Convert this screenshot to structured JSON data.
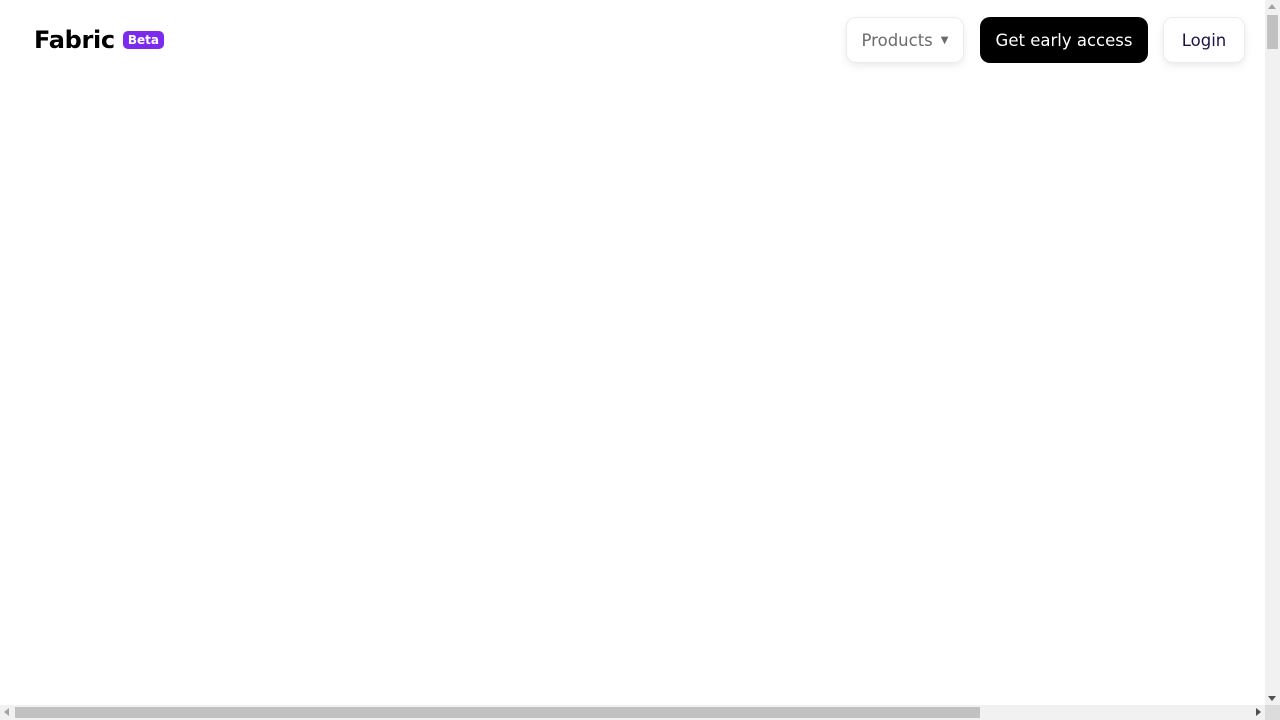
{
  "header": {
    "brand_name": "Fabric",
    "badge": "Beta",
    "badge_color": "#7c2bee"
  },
  "nav": {
    "products_label": "Products",
    "products_icon": "caret-down-icon",
    "early_access_label": "Get early access",
    "login_label": "Login"
  },
  "scrollbars": {
    "vertical_icons": [
      "arrow-up-icon",
      "arrow-down-icon"
    ],
    "horizontal_icons": [
      "arrow-left-icon",
      "arrow-right-icon"
    ]
  }
}
